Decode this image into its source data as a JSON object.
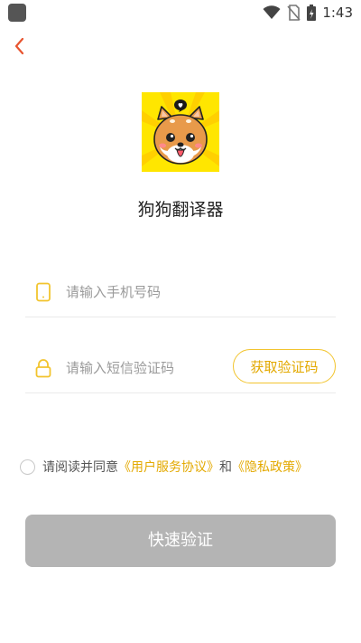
{
  "status_bar": {
    "time": "1:43",
    "icons": [
      "wifi-icon",
      "no-sim-icon",
      "battery-charging-icon"
    ]
  },
  "navigation": {
    "back_icon": "chevron-left-icon"
  },
  "app": {
    "name": "狗狗翻译器",
    "logo_icon": "shiba-dog-face-icon"
  },
  "form": {
    "phone_placeholder": "请输入手机号码",
    "phone_value": "",
    "phone_icon": "mobile-phone-icon",
    "code_placeholder": "请输入短信验证码",
    "code_value": "",
    "code_icon": "lock-icon",
    "get_code_label": "获取验证码"
  },
  "agreement": {
    "prefix": "请阅读并同意",
    "user_agreement": "《用户服务协议》",
    "conjunction": "和",
    "privacy_policy": "《隐私政策》",
    "checked": false
  },
  "submit": {
    "label": "快速验证"
  },
  "colors": {
    "accent": "#F2C42E",
    "accent_text": "#E3A900",
    "button_disabled": "#B4B4B4",
    "back": "#E8542F"
  }
}
